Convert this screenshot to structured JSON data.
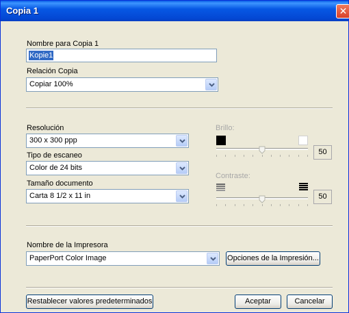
{
  "window": {
    "title": "Copia 1",
    "close_glyph": "✕"
  },
  "name_section": {
    "label": "Nombre para Copia 1",
    "value": "Kopie1",
    "relation_label": "Relación Copia",
    "relation_value": "Copiar 100%"
  },
  "resolution": {
    "label": "Resolución",
    "value": "300 x 300 ppp"
  },
  "scan_type": {
    "label": "Tipo de escaneo",
    "value": "Color de 24 bits"
  },
  "doc_size": {
    "label": "Tamaño documento",
    "value": "Carta 8 1/2 x 11 in"
  },
  "brightness": {
    "label": "Brillo:",
    "value": "50",
    "level": 50
  },
  "contrast": {
    "label": "Contraste:",
    "value": "50",
    "level": 50
  },
  "printer": {
    "label": "Nombre de la Impresora",
    "value": "PaperPort Color Image",
    "options_label": "Opciones de la Impresión..."
  },
  "buttons": {
    "reset": "Restablecer valores predeterminados",
    "ok": "Aceptar",
    "cancel": "Cancelar"
  },
  "colors": {
    "titlebar": "#0758e4",
    "dialog_bg": "#ece9d8",
    "selection": "#316ac5"
  },
  "icons": {
    "dropdown": "chevron-down-icon",
    "brightness_low": "black-square-icon",
    "brightness_high": "white-square-icon",
    "contrast_low": "low-contrast-lines-icon",
    "contrast_high": "high-contrast-lines-icon"
  }
}
